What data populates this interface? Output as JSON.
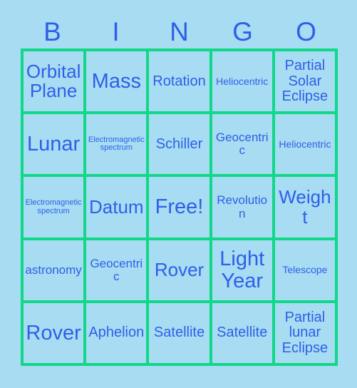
{
  "card": {
    "title": "Bingo Card",
    "colors": {
      "background": "#a7dcf2",
      "cell_background": "#a7dcf2",
      "grid_line": "#10d888",
      "text": "#2f5fe8"
    },
    "header": {
      "letters": [
        "B",
        "I",
        "N",
        "G",
        "O"
      ]
    },
    "grid": {
      "rows": 5,
      "columns": 5,
      "cells": [
        [
          {
            "label": "Orbital Plane",
            "size": "lg"
          },
          {
            "label": "Mass",
            "size": "xl"
          },
          {
            "label": "Rotation",
            "size": "md"
          },
          {
            "label": "Heliocentric",
            "size": "xs"
          },
          {
            "label": "Partial Solar Eclipse",
            "size": "md"
          }
        ],
        [
          {
            "label": "Lunar",
            "size": "xl"
          },
          {
            "label": "Electromagnetic spectrum",
            "size": "xxs"
          },
          {
            "label": "Schiller",
            "size": "md"
          },
          {
            "label": "Geocentric",
            "size": "sm"
          },
          {
            "label": "Heliocentric",
            "size": "xs"
          }
        ],
        [
          {
            "label": "Electromagnetic spectrum",
            "size": "xxs"
          },
          {
            "label": "Datum",
            "size": "lg"
          },
          {
            "label": "Free!",
            "size": "xl"
          },
          {
            "label": "Revolution",
            "size": "sm"
          },
          {
            "label": "Weight",
            "size": "lg"
          }
        ],
        [
          {
            "label": "astronomy",
            "size": "sm"
          },
          {
            "label": "Geocentric",
            "size": "sm"
          },
          {
            "label": "Rover",
            "size": "lg"
          },
          {
            "label": "Light Year",
            "size": "xl"
          },
          {
            "label": "Telescope",
            "size": "xs"
          }
        ],
        [
          {
            "label": "Rover",
            "size": "xl"
          },
          {
            "label": "Aphelion",
            "size": "md"
          },
          {
            "label": "Satellite",
            "size": "md"
          },
          {
            "label": "Satellite",
            "size": "md"
          },
          {
            "label": "Partial lunar Eclipse",
            "size": "md"
          }
        ]
      ]
    }
  }
}
